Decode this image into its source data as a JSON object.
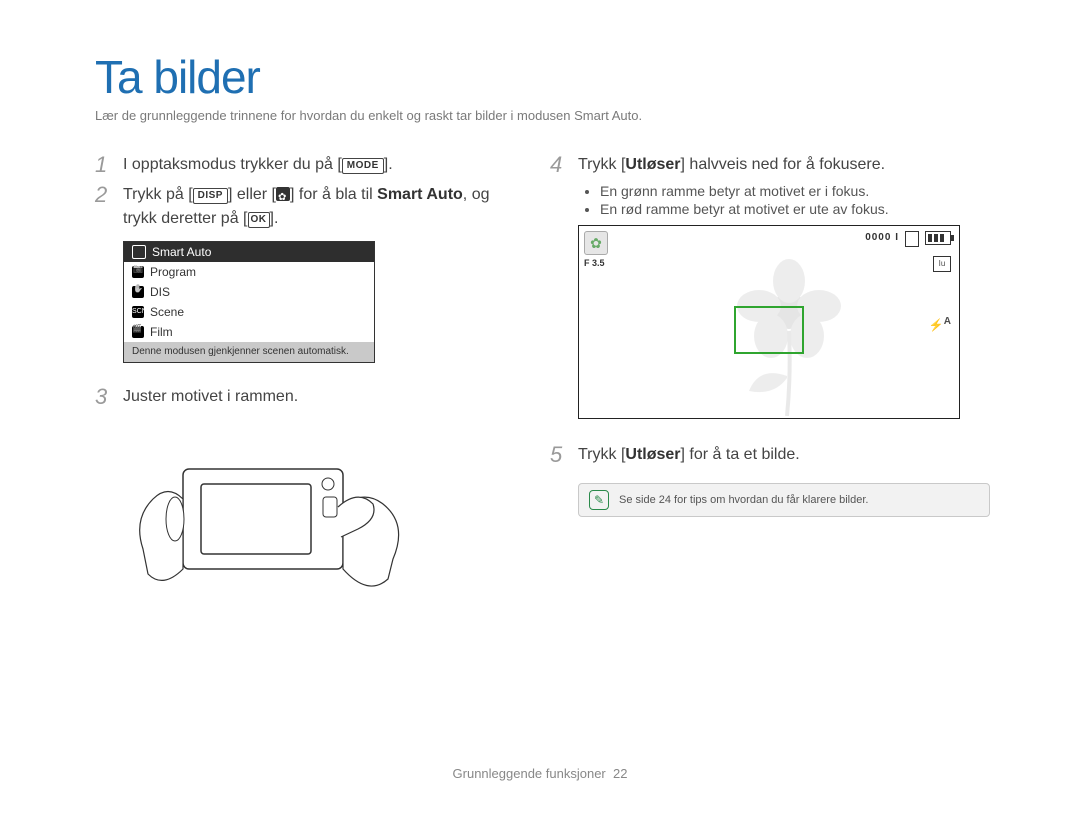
{
  "title": "Ta bilder",
  "subtitle": "Lær de grunnleggende trinnene for hvordan du enkelt og raskt tar bilder i modusen Smart Auto.",
  "steps": {
    "s1": {
      "num": "1",
      "prefix": "I opptaksmodus trykker du på [",
      "mode_label": "MODE",
      "suffix": "]."
    },
    "s2": {
      "num": "2",
      "p1": "Trykk på [",
      "disp_label": "DISP",
      "p2": "] eller [",
      "p3": "] for å bla til ",
      "bold": "Smart Auto",
      "p4": ", og trykk deretter på [",
      "ok_label": "OK",
      "p5": "]."
    },
    "s3": {
      "num": "3",
      "text": "Juster motivet i rammen."
    },
    "s4": {
      "num": "4",
      "p1": "Trykk [",
      "bold": "Utløser",
      "p2": "] halvveis ned for å fokusere.",
      "b1": "En grønn ramme betyr at motivet er i fokus.",
      "b2": "En rød ramme betyr at motivet er ute av fokus."
    },
    "s5": {
      "num": "5",
      "p1": "Trykk [",
      "bold": "Utløser",
      "p2": "] for å ta et bilde."
    }
  },
  "mode_menu": {
    "selected": "Smart Auto",
    "program": "Program",
    "dis": "DIS",
    "scene": "Scene",
    "scn_icon": "SCN",
    "film": "Film",
    "desc": "Denne modusen gjenkjenner scenen automatisk."
  },
  "lcd": {
    "fnum": "F 3.5",
    "count": "0000 I",
    "res": "Iu",
    "flash": "A",
    "flash_glyph": "⚡"
  },
  "tip": "Se side 24 for tips om hvordan du får klarere bilder.",
  "footer": {
    "label": "Grunnleggende funksjoner",
    "page": "22"
  }
}
